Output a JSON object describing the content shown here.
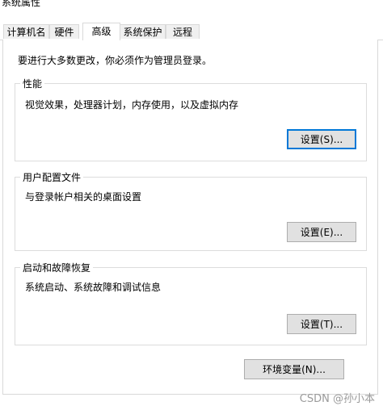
{
  "window": {
    "title": "系统属性"
  },
  "tabs": [
    {
      "label": "计算机名",
      "active": false
    },
    {
      "label": "硬件",
      "active": false
    },
    {
      "label": "高级",
      "active": true
    },
    {
      "label": "系统保护",
      "active": false
    },
    {
      "label": "远程",
      "active": false
    }
  ],
  "notice": "要进行大多数更改，你必须作为管理员登录。",
  "performance": {
    "title": "性能",
    "description": "视觉效果，处理器计划，内存使用，以及虚拟内存",
    "button": "设置(S)..."
  },
  "user_profiles": {
    "title": "用户配置文件",
    "description": "与登录帐户相关的桌面设置",
    "button": "设置(E)..."
  },
  "startup_recovery": {
    "title": "启动和故障恢复",
    "description": "系统启动、系统故障和调试信息",
    "button": "设置(T)..."
  },
  "env_button": "环境变量(N)...",
  "watermark": "CSDN @孙小本"
}
